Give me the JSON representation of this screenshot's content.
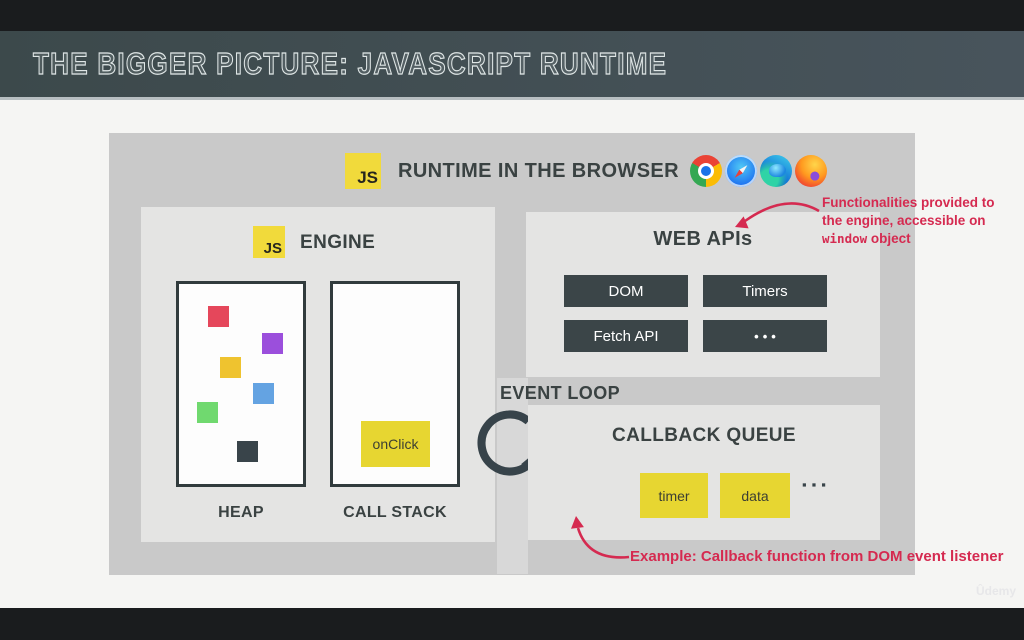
{
  "slide": {
    "title": "THE BIGGER PICTURE: JAVASCRIPT RUNTIME",
    "watermark": "Ûdemy"
  },
  "runtime": {
    "js_badge": "JS",
    "title": "RUNTIME IN THE BROWSER",
    "browser_icons": [
      "chrome",
      "safari",
      "edge",
      "firefox"
    ]
  },
  "engine": {
    "js_badge": "JS",
    "title": "ENGINE",
    "heap_label": "HEAP",
    "call_stack_label": "CALL STACK",
    "call_stack_frame": "onClick",
    "heap_square_colors": [
      "#e5475b",
      "#9b4fdc",
      "#efc32f",
      "#64a3e2",
      "#70d96f",
      "#39444a"
    ]
  },
  "web_apis": {
    "title": "WEB APIs",
    "buttons": [
      "DOM",
      "Timers",
      "Fetch API",
      "•••"
    ]
  },
  "event_loop": {
    "label": "EVENT LOOP"
  },
  "callback_queue": {
    "title": "CALLBACK QUEUE",
    "items": [
      "timer",
      "data"
    ],
    "ellipsis": "▪▪▪"
  },
  "annotations": {
    "color": "#d52a50",
    "web_apis_note_line1": "Functionalities provided to",
    "web_apis_note_line2": "the engine, accessible on",
    "web_apis_note_code": "window",
    "web_apis_note_rest": " object",
    "callback_note": "Example: Callback function from DOM event listener"
  },
  "colors": {
    "container": "#c9c9c9",
    "panel": "#e4e4e3",
    "dark_slate": "#3b4548",
    "yellow": "#e7d631",
    "js_yellow": "#f1da3b",
    "header": "#3f4c50"
  }
}
